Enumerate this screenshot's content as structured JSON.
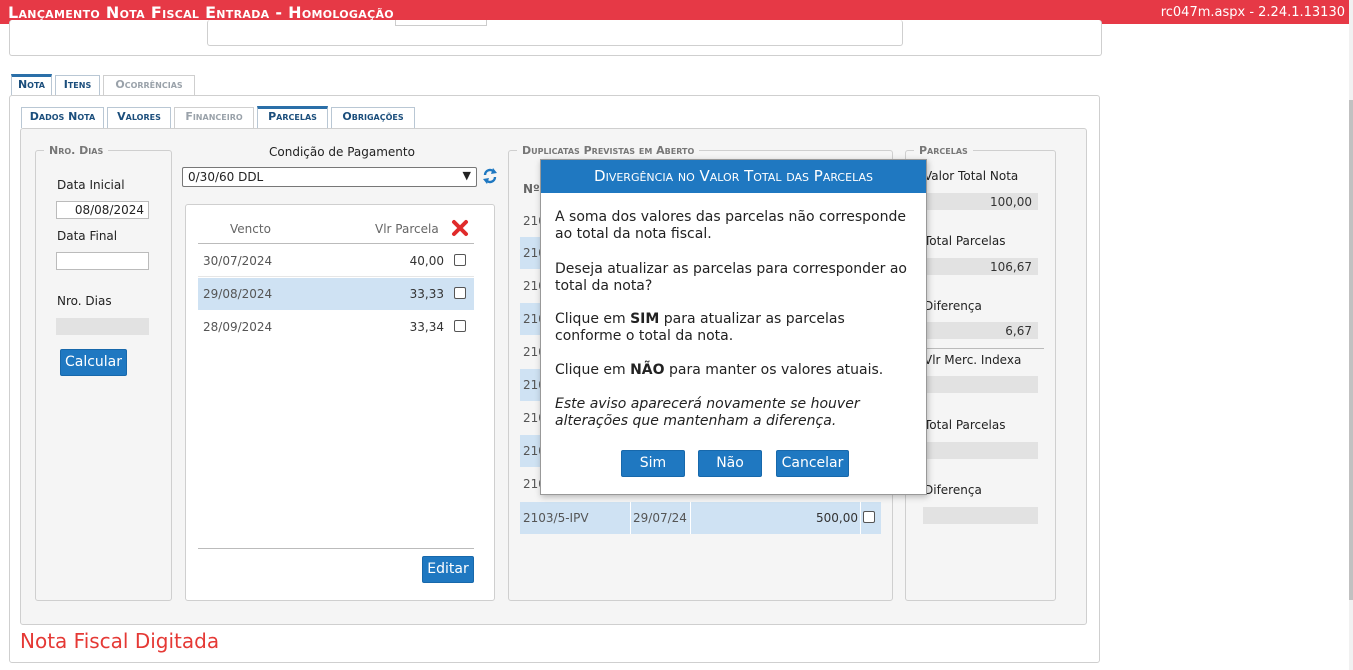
{
  "header": {
    "title": "Lançamento Nota Fiscal Entrada  - Homologação",
    "version": "rc047m.aspx - 2.24.1.13130"
  },
  "tabs_main": [
    {
      "label": "Nota"
    },
    {
      "label": "Itens"
    },
    {
      "label": "Ocorrências"
    }
  ],
  "tabs_sub": [
    {
      "label": "Dados Nota"
    },
    {
      "label": "Valores"
    },
    {
      "label": "Financeiro"
    },
    {
      "label": "Parcelas"
    },
    {
      "label": "Obrigações"
    }
  ],
  "nro_dias": {
    "legend": "Nro. Dias",
    "data_inicial_label": "Data Inicial",
    "data_inicial_value": "08/08/2024",
    "data_final_label": "Data Final",
    "data_final_value": "",
    "nro_dias_label": "Nro. Dias",
    "nro_dias_value": "",
    "calcular_label": "Calcular"
  },
  "condicao": {
    "label": "Condição de Pagamento",
    "selected": "0/30/60 DDL",
    "table_headers": {
      "vencto": "Vencto",
      "vlr": "Vlr Parcela"
    },
    "rows": [
      {
        "vencto": "30/07/2024",
        "vlr": "40,00"
      },
      {
        "vencto": "29/08/2024",
        "vlr": "33,33"
      },
      {
        "vencto": "28/09/2024",
        "vlr": "33,34"
      }
    ],
    "editar_label": "Editar"
  },
  "duplicatas": {
    "legend": "Duplicatas Previstas em Aberto",
    "col_header": "Nº",
    "row_prefixes": [
      "210",
      "210",
      "210",
      "210",
      "210",
      "210",
      "210",
      "210",
      "210"
    ],
    "last_row": {
      "doc": "2103/5-IPV",
      "data": "29/07/24",
      "valor": "500,00"
    }
  },
  "parcelas": {
    "legend": "Parcelas",
    "valor_total_nota_label": "Valor Total Nota",
    "valor_total_nota": "100,00",
    "total_parcelas_label": "Total Parcelas",
    "total_parcelas": "106,67",
    "diferenca_label": "Diferença",
    "diferenca": "6,67",
    "vlr_merc_label": "Vlr Merc. Indexa",
    "total_parcelas2_label": "Total Parcelas",
    "diferenca2_label": "Diferença"
  },
  "status": "Nota Fiscal Digitada",
  "modal": {
    "title": "Divergência no Valor Total das Parcelas",
    "p1": "A soma dos valores das parcelas não corresponde ao total da nota fiscal.",
    "p2": "Deseja atualizar as parcelas para corresponder ao total da nota?",
    "p3_pre": "Clique em ",
    "p3_bold": "SIM",
    "p3_post": " para atualizar as parcelas conforme o total da nota.",
    "p4_pre": "Clique em ",
    "p4_bold": "NÃO",
    "p4_post": " para manter os valores atuais.",
    "p5": "Este aviso aparecerá novamente se houver alterações que mantenham a diferença.",
    "btn_sim": "Sim",
    "btn_nao": "Não",
    "btn_cancelar": "Cancelar"
  },
  "colors": {
    "titlebar": "#e63946",
    "accent": "#1f78c1",
    "row_highlight": "#cfe2f3",
    "status_red": "#e53935"
  }
}
